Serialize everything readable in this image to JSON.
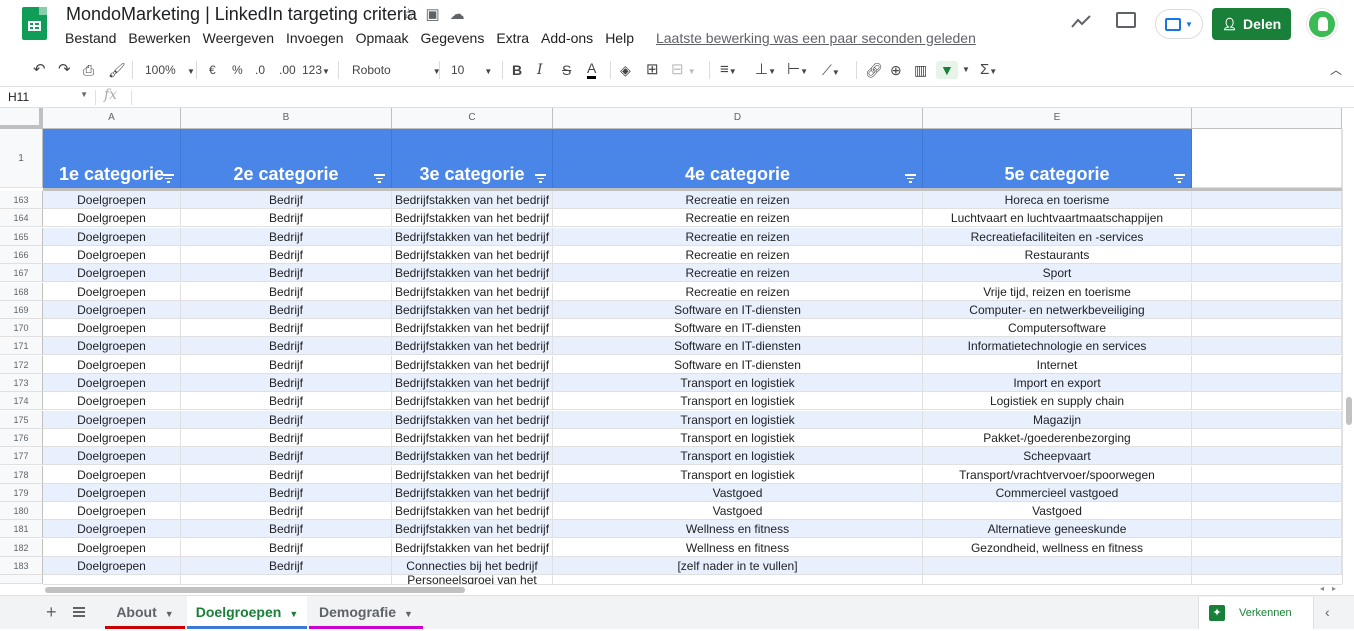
{
  "app": {
    "title": "MondoMarketing | LinkedIn targeting criteria",
    "menu": [
      "Bestand",
      "Bewerken",
      "Weergeven",
      "Invoegen",
      "Opmaak",
      "Gegevens",
      "Extra",
      "Add-ons",
      "Help"
    ],
    "last_edit": "Laatste bewerking was een paar seconden geleden",
    "share_label": "Delen",
    "star_icon": "star-icon",
    "accent": "#188038",
    "header_fill": "#4a86e8",
    "band_fill": "#e8f0fe"
  },
  "toolbar": {
    "zoom": "100%",
    "currency": "€",
    "percent": "%",
    "dec_less": ".0",
    "dec_more": ".00",
    "format_more": "123",
    "font": "Roboto",
    "font_size": "10",
    "bold": "B",
    "italic": "I",
    "strike": "S",
    "text_color": "A"
  },
  "formula": {
    "cell_ref": "H11",
    "fx": "fx",
    "value": ""
  },
  "columns": [
    "A",
    "B",
    "C",
    "D",
    "E"
  ],
  "header_row": {
    "row_number": "1",
    "cells": [
      "1e categorie",
      "2e categorie",
      "3e categorie",
      "4e categorie",
      "5e categorie"
    ]
  },
  "rows": [
    {
      "n": "163",
      "a": "Doelgroepen",
      "b": "Bedrijf",
      "c": "Bedrijfstakken van het bedrijf",
      "d": "Recreatie en reizen",
      "e": "Horeca en toerisme"
    },
    {
      "n": "164",
      "a": "Doelgroepen",
      "b": "Bedrijf",
      "c": "Bedrijfstakken van het bedrijf",
      "d": "Recreatie en reizen",
      "e": "Luchtvaart en luchtvaartmaatschappijen"
    },
    {
      "n": "165",
      "a": "Doelgroepen",
      "b": "Bedrijf",
      "c": "Bedrijfstakken van het bedrijf",
      "d": "Recreatie en reizen",
      "e": "Recreatiefaciliteiten en -services"
    },
    {
      "n": "166",
      "a": "Doelgroepen",
      "b": "Bedrijf",
      "c": "Bedrijfstakken van het bedrijf",
      "d": "Recreatie en reizen",
      "e": "Restaurants"
    },
    {
      "n": "167",
      "a": "Doelgroepen",
      "b": "Bedrijf",
      "c": "Bedrijfstakken van het bedrijf",
      "d": "Recreatie en reizen",
      "e": "Sport"
    },
    {
      "n": "168",
      "a": "Doelgroepen",
      "b": "Bedrijf",
      "c": "Bedrijfstakken van het bedrijf",
      "d": "Recreatie en reizen",
      "e": "Vrije tijd, reizen en toerisme"
    },
    {
      "n": "169",
      "a": "Doelgroepen",
      "b": "Bedrijf",
      "c": "Bedrijfstakken van het bedrijf",
      "d": "Software en IT-diensten",
      "e": "Computer- en netwerkbeveiliging"
    },
    {
      "n": "170",
      "a": "Doelgroepen",
      "b": "Bedrijf",
      "c": "Bedrijfstakken van het bedrijf",
      "d": "Software en IT-diensten",
      "e": "Computersoftware"
    },
    {
      "n": "171",
      "a": "Doelgroepen",
      "b": "Bedrijf",
      "c": "Bedrijfstakken van het bedrijf",
      "d": "Software en IT-diensten",
      "e": "Informatietechnologie en services"
    },
    {
      "n": "172",
      "a": "Doelgroepen",
      "b": "Bedrijf",
      "c": "Bedrijfstakken van het bedrijf",
      "d": "Software en IT-diensten",
      "e": "Internet"
    },
    {
      "n": "173",
      "a": "Doelgroepen",
      "b": "Bedrijf",
      "c": "Bedrijfstakken van het bedrijf",
      "d": "Transport en logistiek",
      "e": "Import en export"
    },
    {
      "n": "174",
      "a": "Doelgroepen",
      "b": "Bedrijf",
      "c": "Bedrijfstakken van het bedrijf",
      "d": "Transport en logistiek",
      "e": "Logistiek en supply chain"
    },
    {
      "n": "175",
      "a": "Doelgroepen",
      "b": "Bedrijf",
      "c": "Bedrijfstakken van het bedrijf",
      "d": "Transport en logistiek",
      "e": "Magazijn"
    },
    {
      "n": "176",
      "a": "Doelgroepen",
      "b": "Bedrijf",
      "c": "Bedrijfstakken van het bedrijf",
      "d": "Transport en logistiek",
      "e": "Pakket-/goederenbezorging"
    },
    {
      "n": "177",
      "a": "Doelgroepen",
      "b": "Bedrijf",
      "c": "Bedrijfstakken van het bedrijf",
      "d": "Transport en logistiek",
      "e": "Scheepvaart"
    },
    {
      "n": "178",
      "a": "Doelgroepen",
      "b": "Bedrijf",
      "c": "Bedrijfstakken van het bedrijf",
      "d": "Transport en logistiek",
      "e": "Transport/vrachtvervoer/spoorwegen"
    },
    {
      "n": "179",
      "a": "Doelgroepen",
      "b": "Bedrijf",
      "c": "Bedrijfstakken van het bedrijf",
      "d": "Vastgoed",
      "e": "Commercieel vastgoed"
    },
    {
      "n": "180",
      "a": "Doelgroepen",
      "b": "Bedrijf",
      "c": "Bedrijfstakken van het bedrijf",
      "d": "Vastgoed",
      "e": "Vastgoed"
    },
    {
      "n": "181",
      "a": "Doelgroepen",
      "b": "Bedrijf",
      "c": "Bedrijfstakken van het bedrijf",
      "d": "Wellness en fitness",
      "e": "Alternatieve geneeskunde"
    },
    {
      "n": "182",
      "a": "Doelgroepen",
      "b": "Bedrijf",
      "c": "Bedrijfstakken van het bedrijf",
      "d": "Wellness en fitness",
      "e": "Gezondheid, wellness en fitness"
    },
    {
      "n": "183",
      "a": "Doelgroepen",
      "b": "Bedrijf",
      "c": "Connecties bij het bedrijf",
      "d": "[zelf nader in te vullen]",
      "e": ""
    }
  ],
  "partial_row": {
    "c": "Personeelsgroei van het"
  },
  "tabs": [
    {
      "label": "About",
      "color": "#cc0000"
    },
    {
      "label": "Doelgroepen",
      "color": "#3c78d8"
    },
    {
      "label": "Demografie",
      "color": "#cc00cc"
    }
  ],
  "explore_label": "Verkennen"
}
